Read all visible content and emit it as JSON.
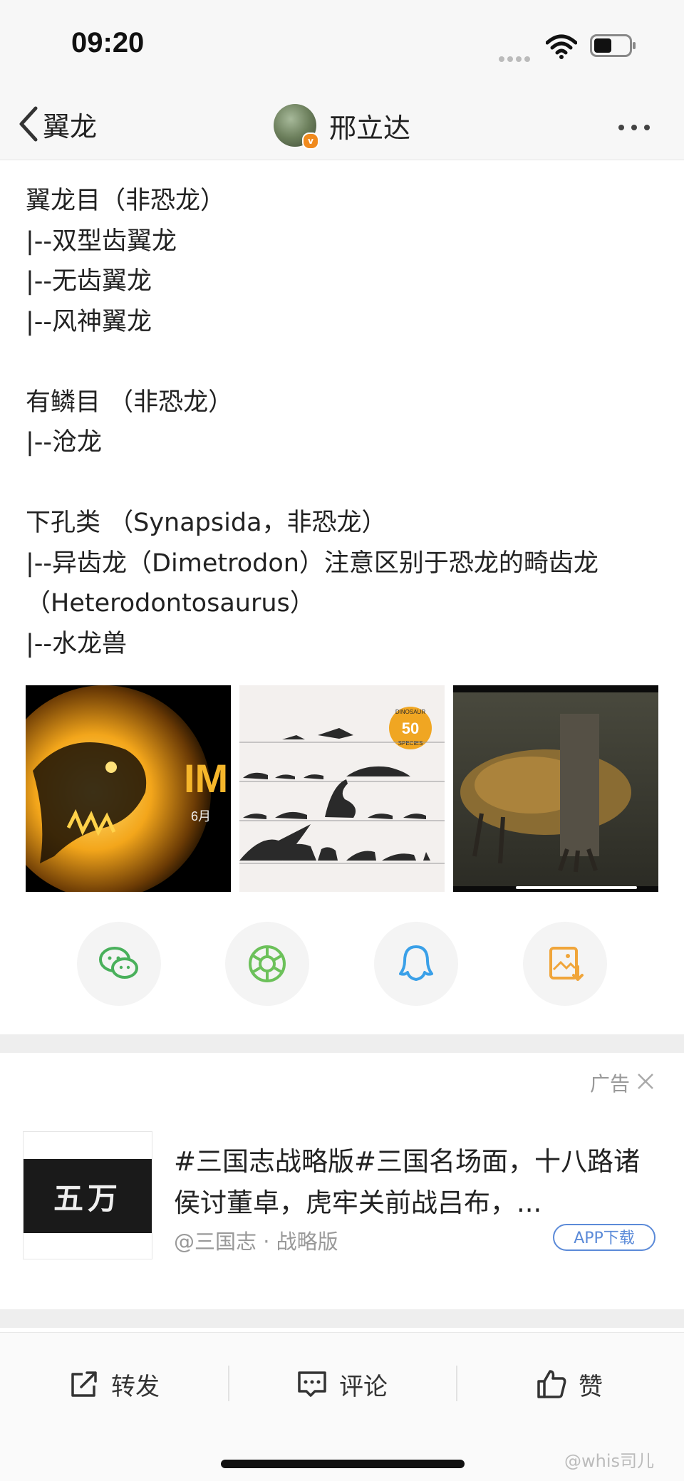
{
  "status": {
    "time": "09:20"
  },
  "nav": {
    "back_label": "翼龙",
    "author_name": "邢立达"
  },
  "article": {
    "lines": [
      "翼龙目（非恐龙）",
      "|--双型齿翼龙",
      "|--无齿翼龙",
      "|--风神翼龙",
      "",
      "有鳞目 （非恐龙）",
      "|--沧龙",
      "",
      "下孔类 （Synapsida，非恐龙）",
      "|--异齿龙（Dimetrodon）注意区别于恐龙的畸齿龙（Heterodontosaurus）",
      "|--水龙兽"
    ]
  },
  "images": [
    {
      "name": "jurassic-world-poster",
      "text": "IM",
      "subtext": "6月"
    },
    {
      "name": "dinosaur-size-chart",
      "badge_top": "DINOSAUR",
      "badge_num": "50",
      "badge_bottom": "SPECIES"
    },
    {
      "name": "dinosaur-video-still"
    }
  ],
  "share": [
    "wechat-icon",
    "moments-icon",
    "qq-icon",
    "save-image-icon"
  ],
  "ad": {
    "label": "广告",
    "thumb_text": "五万",
    "title": "#三国志战略版#三国名场面，十八路诸侯讨董卓，虎牢关前战吕布，...",
    "source": "@三国志 · 战略版",
    "app_button": "APP下载"
  },
  "toolbar": {
    "repost": "转发",
    "comment": "评论",
    "like": "赞"
  },
  "watermark": "@whis司儿"
}
